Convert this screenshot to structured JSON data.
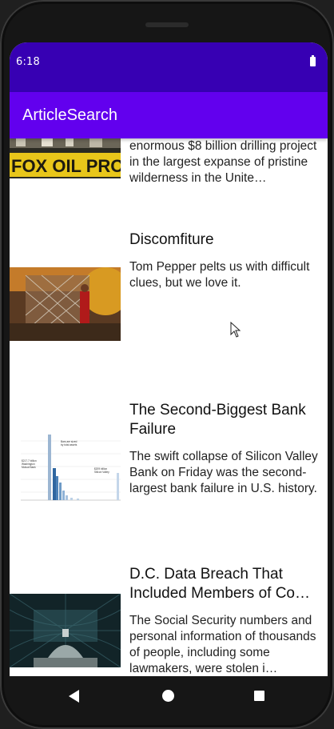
{
  "status_bar": {
    "time": "6:18",
    "battery_icon": "battery-full-icon"
  },
  "app_bar": {
    "title": "ArticleSearch"
  },
  "articles": [
    {
      "headline": "",
      "snippet": "enormous $8 billion drilling project in the largest expanse of pristine wilderness in the Unite…",
      "thumbnail": "protest-banner-photo"
    },
    {
      "headline": "Discomfiture",
      "snippet": "Tom Pepper pelts us with difficult clues, but we love it.",
      "thumbnail": "crowd-cage-photo"
    },
    {
      "headline": "The Second-Biggest Bank Failure",
      "snippet": "The swift collapse of Silicon Valley Bank on Friday was the second-largest bank failure in U.S. history.",
      "thumbnail": "bank-failure-chart"
    },
    {
      "headline": "D.C. Data Breach That Included Members of Co…",
      "snippet": "The Social Security numbers and personal information of thousands of people, including some lawmakers, were stolen i…",
      "thumbnail": "capitol-dome-photo"
    }
  ],
  "nav_bar": {
    "back_icon": "back-triangle-icon",
    "home_icon": "home-circle-icon",
    "recents_icon": "recents-square-icon"
  }
}
